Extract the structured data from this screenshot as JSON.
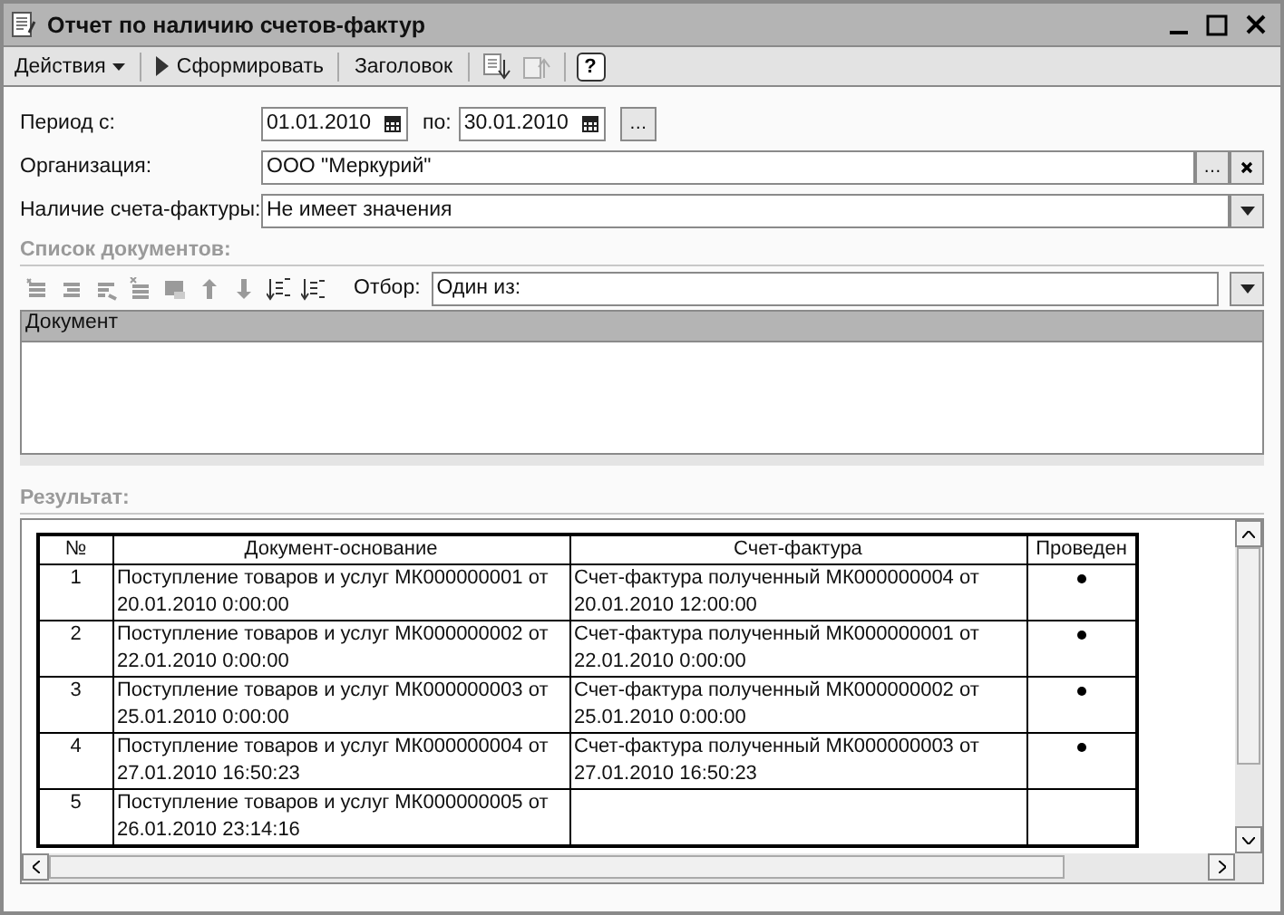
{
  "window": {
    "title": "Отчет по наличию счетов-фактур"
  },
  "toolbar": [
    {
      "kind": "menu",
      "label": "Действия"
    },
    {
      "kind": "run",
      "label": "Сформировать"
    },
    {
      "kind": "text",
      "label": "Заголовок"
    }
  ],
  "help_button": "?",
  "period": {
    "label": "Период с:",
    "from": "01.01.2010",
    "to_label": "по:",
    "to": "30.01.2010",
    "select_button": "…"
  },
  "organization": {
    "label": "Организация:",
    "value": "ООО \"Меркурий\"",
    "select_button": "…"
  },
  "invoice_presence": {
    "label": "Наличие счета-фактуры:",
    "value": "Не имеет значения"
  },
  "documents": {
    "title": "Список документов:",
    "filter_label": "Отбор:",
    "filter_value": "Один из:",
    "column": "Документ"
  },
  "result": {
    "title": "Результат:",
    "columns": [
      "№",
      "Документ-основание",
      "Счет-фактура",
      "Проведен"
    ],
    "rows": [
      {
        "number": "1",
        "basis": "Поступление товаров и услуг МК000000001 от 20.01.2010 0:00:00",
        "invoice": "Счет-фактура полученный МК000000004 от 20.01.2010 12:00:00",
        "posted": true
      },
      {
        "number": "2",
        "basis": "Поступление товаров и услуг МК000000002 от 22.01.2010 0:00:00",
        "invoice": "Счет-фактура полученный МК000000001 от 22.01.2010 0:00:00",
        "posted": true
      },
      {
        "number": "3",
        "basis": "Поступление товаров и услуг МК000000003 от 25.01.2010 0:00:00",
        "invoice": "Счет-фактура полученный МК000000002 от 25.01.2010 0:00:00",
        "posted": true
      },
      {
        "number": "4",
        "basis": "Поступление товаров и услуг МК000000004 от 27.01.2010 16:50:23",
        "invoice": "Счет-фактура полученный МК000000003 от 27.01.2010 16:50:23",
        "posted": true
      },
      {
        "number": "5",
        "basis": "Поступление товаров и услуг МК000000005 от 26.01.2010 23:14:16",
        "invoice": "",
        "posted": false
      }
    ]
  }
}
